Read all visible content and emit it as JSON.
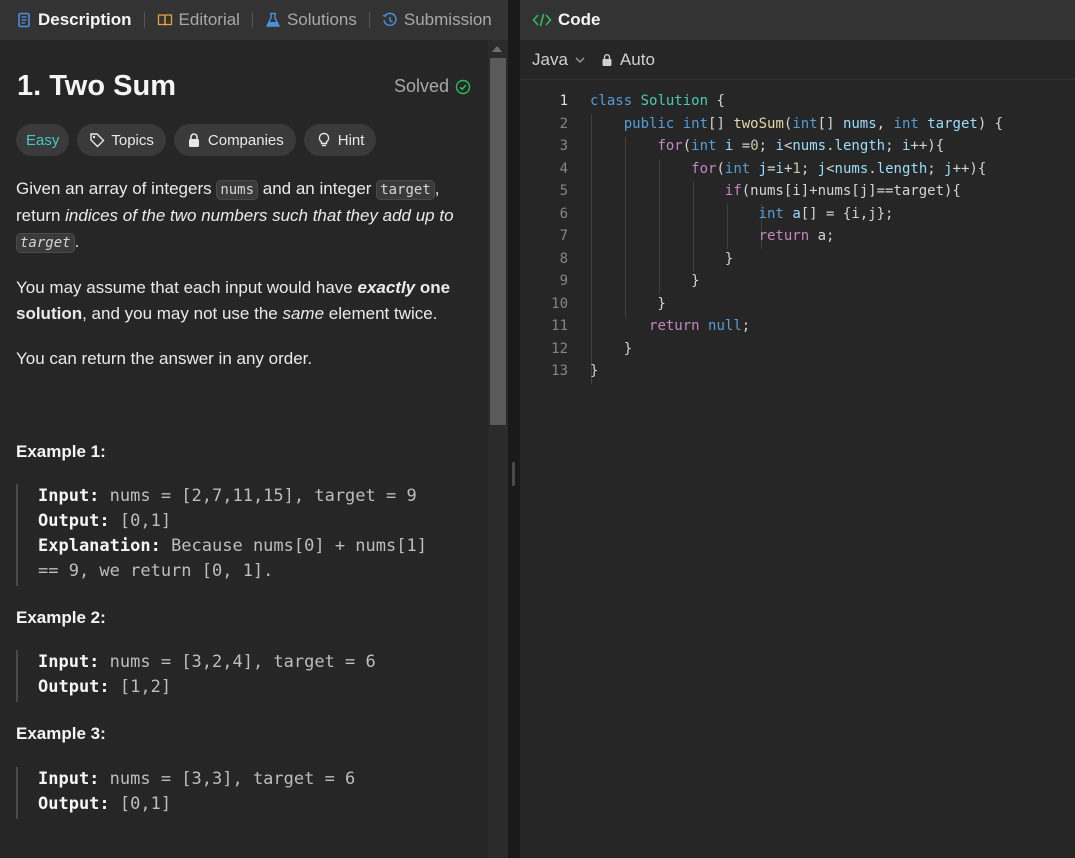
{
  "tabs": [
    {
      "label": "Description",
      "icon": "description-icon",
      "active": true
    },
    {
      "label": "Editorial",
      "icon": "book-icon"
    },
    {
      "label": "Solutions",
      "icon": "flask-icon"
    },
    {
      "label": "Submission",
      "icon": "history-icon"
    }
  ],
  "problem": {
    "title": "1. Two Sum",
    "status": "Solved",
    "difficulty": "Easy",
    "chips": [
      "Topics",
      "Companies",
      "Hint"
    ],
    "desc1_a": "Given an array of integers ",
    "desc1_code1": "nums",
    "desc1_b": " and an integer ",
    "desc1_code2": "target",
    "desc1_c": ", return ",
    "desc1_em": "indices of the two numbers such that they add up to",
    "desc1_code3": "target",
    "desc1_d": ".",
    "desc2_a": "You may assume that each input would have ",
    "desc2_b1": "exactly",
    "desc2_b2": " one solution",
    "desc2_c": ", and you may not use the ",
    "desc2_em": "same",
    "desc2_d": " element twice.",
    "desc3": "You can return the answer in any order."
  },
  "examples": [
    {
      "title": "Example 1:",
      "input_label": "Input:",
      "input": " nums = [2,7,11,15], target = 9",
      "output_label": "Output:",
      "output": " [0,1]",
      "explanation_label": "Explanation:",
      "explanation_1": " Because nums[0] + nums[1]",
      "explanation_2": "== 9, we return [0, 1]."
    },
    {
      "title": "Example 2:",
      "input_label": "Input:",
      "input": " nums = [3,2,4], target = 6",
      "output_label": "Output:",
      "output": " [1,2]"
    },
    {
      "title": "Example 3:",
      "input_label": "Input:",
      "input": " nums = [3,3], target = 6",
      "output_label": "Output:",
      "output": " [0,1]"
    }
  ],
  "editor": {
    "header": "Code",
    "language": "Java",
    "mode": "Auto",
    "line_numbers": [
      "1",
      "2",
      "3",
      "4",
      "5",
      "6",
      "7",
      "8",
      "9",
      "10",
      "11",
      "12",
      "13"
    ]
  },
  "colors": {
    "accent_easy": "#46c6c2",
    "solved_green": "#2cbb5d",
    "tab_blue": "#4a90e2",
    "code_header_green": "#2cbb5d"
  }
}
